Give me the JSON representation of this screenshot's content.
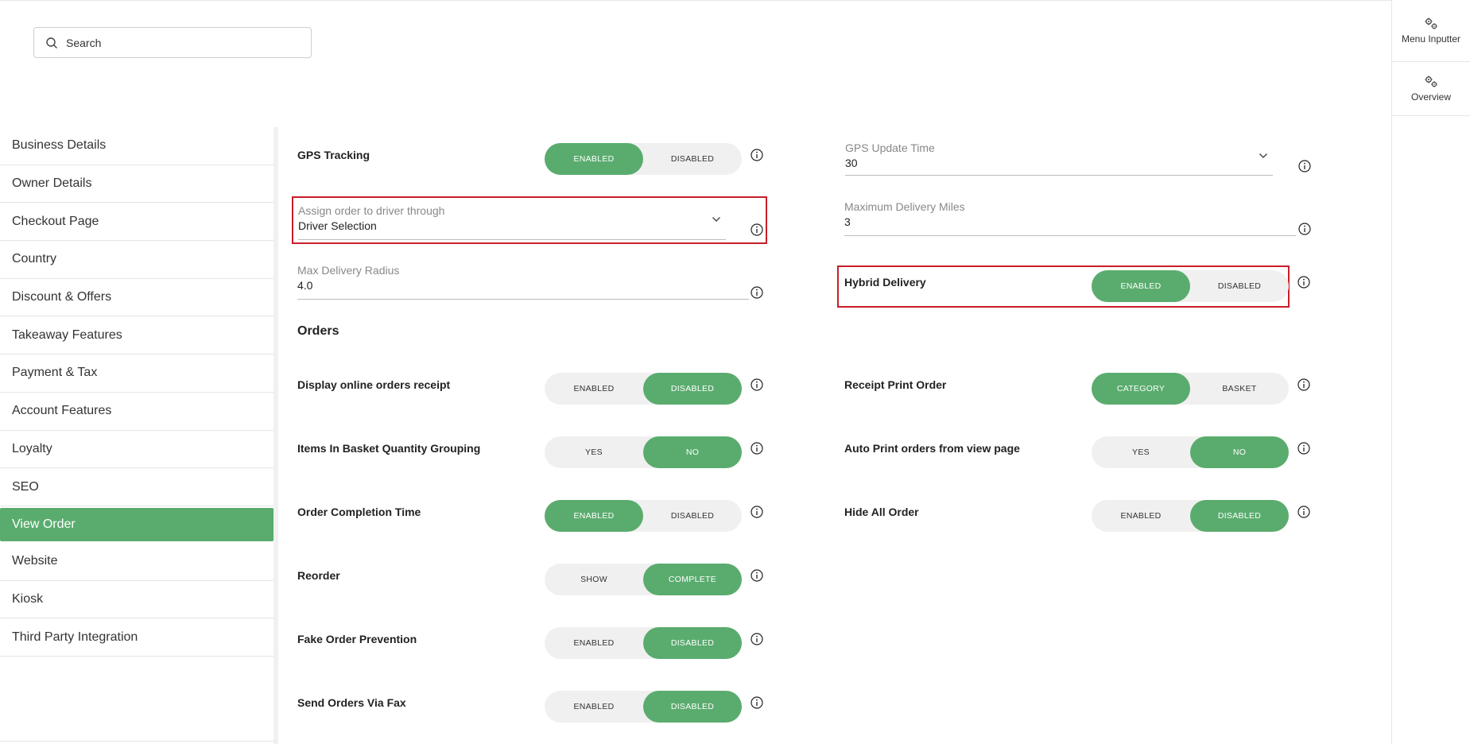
{
  "search": {
    "placeholder": "Search"
  },
  "rail": [
    {
      "label": "Menu Inputter",
      "icon": "gears-icon"
    },
    {
      "label": "Overview",
      "icon": "gears-icon"
    }
  ],
  "sidebar": {
    "items": [
      {
        "label": "Business Details"
      },
      {
        "label": "Owner Details"
      },
      {
        "label": "Checkout Page"
      },
      {
        "label": "Country"
      },
      {
        "label": "Discount & Offers"
      },
      {
        "label": "Takeaway Features"
      },
      {
        "label": "Payment & Tax"
      },
      {
        "label": "Account Features"
      },
      {
        "label": "Loyalty"
      },
      {
        "label": "SEO"
      },
      {
        "label": "View Order",
        "active": true
      },
      {
        "label": "Website"
      },
      {
        "label": "Kiosk"
      },
      {
        "label": "Third Party Integration"
      }
    ]
  },
  "delivery": {
    "gps_tracking": {
      "label": "GPS Tracking",
      "options": [
        "ENABLED",
        "DISABLED"
      ],
      "selected": "ENABLED"
    },
    "gps_update_time": {
      "label": "GPS Update Time",
      "value": "30"
    },
    "assign_order": {
      "label": "Assign order to driver through",
      "value": "Driver Selection"
    },
    "max_delivery_miles": {
      "label": "Maximum Delivery Miles",
      "value": "3"
    },
    "max_delivery_radius": {
      "label": "Max Delivery Radius",
      "value": "4.0"
    },
    "hybrid_delivery": {
      "label": "Hybrid Delivery",
      "options": [
        "ENABLED",
        "DISABLED"
      ],
      "selected": "ENABLED"
    }
  },
  "orders": {
    "title": "Orders",
    "display_receipt": {
      "label": "Display online orders receipt",
      "options": [
        "ENABLED",
        "DISABLED"
      ],
      "selected": "DISABLED"
    },
    "receipt_print_order": {
      "label": "Receipt Print Order",
      "options": [
        "CATEGORY",
        "BASKET"
      ],
      "selected": "CATEGORY"
    },
    "basket_grouping": {
      "label": "Items In Basket Quantity Grouping",
      "options": [
        "YES",
        "NO"
      ],
      "selected": "NO"
    },
    "auto_print": {
      "label": "Auto Print orders from view page",
      "options": [
        "YES",
        "NO"
      ],
      "selected": "NO"
    },
    "completion_time": {
      "label": "Order Completion Time",
      "options": [
        "ENABLED",
        "DISABLED"
      ],
      "selected": "ENABLED"
    },
    "hide_all_order": {
      "label": "Hide All Order",
      "options": [
        "ENABLED",
        "DISABLED"
      ],
      "selected": "DISABLED"
    },
    "reorder": {
      "label": "Reorder",
      "options": [
        "SHOW",
        "COMPLETE"
      ],
      "selected": "COMPLETE"
    },
    "fake_order_prevention": {
      "label": "Fake Order Prevention",
      "options": [
        "ENABLED",
        "DISABLED"
      ],
      "selected": "DISABLED"
    },
    "send_via_fax": {
      "label": "Send Orders Via Fax",
      "options": [
        "ENABLED",
        "DISABLED"
      ],
      "selected": "DISABLED"
    }
  },
  "colors": {
    "accent": "#5aac6e",
    "highlight": "#c81e2a"
  }
}
